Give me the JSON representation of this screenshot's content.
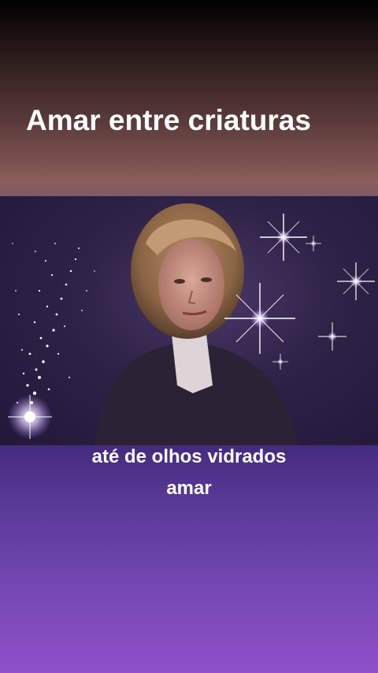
{
  "overlay_title": "Amar entre criaturas",
  "captions": {
    "line1": "até de olhos vidrados",
    "line2": "amar"
  },
  "colors": {
    "text": "#ffffff",
    "accent_purple": "#8a4ac0"
  }
}
